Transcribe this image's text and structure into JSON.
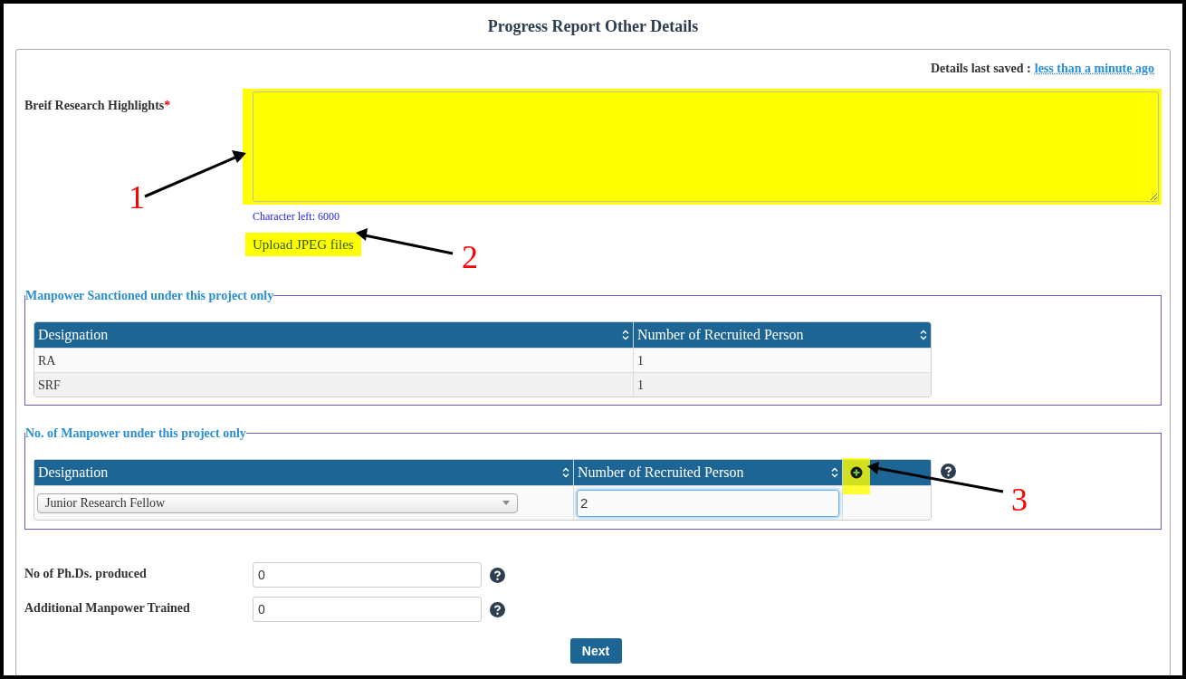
{
  "title": "Progress Report Other Details",
  "last_saved": {
    "label": "Details last saved :",
    "value": "less than a minute ago"
  },
  "highlights": {
    "label": "Breif Research Highlights",
    "required_mark": "*",
    "highlighted": true,
    "counter": "Character left: 6000"
  },
  "upload": {
    "label": "Upload JPEG files",
    "highlighted": true
  },
  "sanctioned": {
    "legend": "Manpower Sanctioned under this project only",
    "columns": [
      "Designation",
      "Number of Recruited Person"
    ],
    "rows": [
      [
        "RA",
        "1"
      ],
      [
        "SRF",
        "1"
      ]
    ]
  },
  "manpower": {
    "legend": "No. of Manpower under this project only",
    "columns": [
      "Designation",
      "Number of Recruited Person"
    ],
    "add_highlighted": true,
    "rows": [
      {
        "designation": "Junior Research Fellow",
        "count": "2",
        "focused": true
      }
    ]
  },
  "fields": [
    {
      "label": "No of Ph.Ds. produced",
      "value": "0"
    },
    {
      "label": "Additional Manpower Trained",
      "value": "0"
    }
  ],
  "next": "Next",
  "annotations": [
    "1",
    "2",
    "3"
  ]
}
